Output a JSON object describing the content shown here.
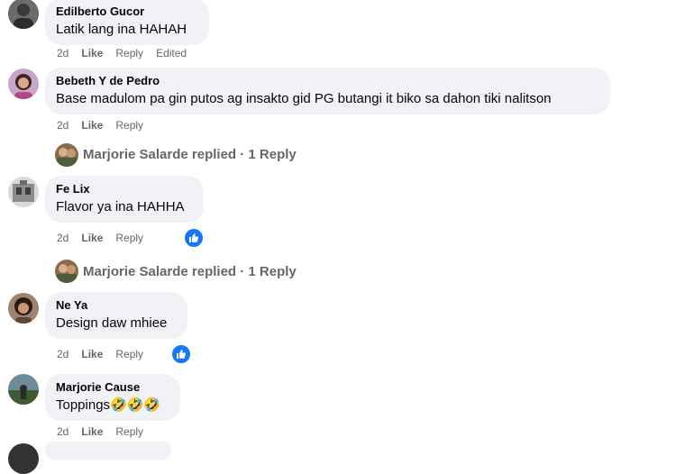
{
  "comments": [
    {
      "author": "Edilberto Gucor",
      "text": "Latik lang ina HAHAH",
      "time": "2d",
      "like": "Like",
      "reply": "Reply",
      "extra": "Edited"
    },
    {
      "author": "Bebeth Y de Pedro",
      "text": "Base madulom pa gin putos ag insakto gid PG butangi it biko sa dahon tiki nalitson",
      "time": "2d",
      "like": "Like",
      "reply": "Reply",
      "replies_summary": "Marjorie Salarde replied · 1 Reply"
    },
    {
      "author": "Fe Lix",
      "text": "Flavor ya ina HAHHA",
      "time": "2d",
      "like": "Like",
      "reply": "Reply",
      "reaction_icon": "thumbs-up-icon",
      "replies_summary": "Marjorie Salarde replied · 1 Reply"
    },
    {
      "author": "Ne Ya",
      "text": "Design daw mhiee",
      "time": "2d",
      "like": "Like",
      "reply": "Reply",
      "reaction_icon": "thumbs-up-icon"
    },
    {
      "author": "Marjorie Cause",
      "text": "Toppings🤣🤣🤣",
      "time": "2d",
      "like": "Like",
      "reply": "Reply"
    }
  ],
  "colors": {
    "bubble": "#f0f2f5",
    "meta_text": "#65676b",
    "like_blue": "#1877f2"
  }
}
